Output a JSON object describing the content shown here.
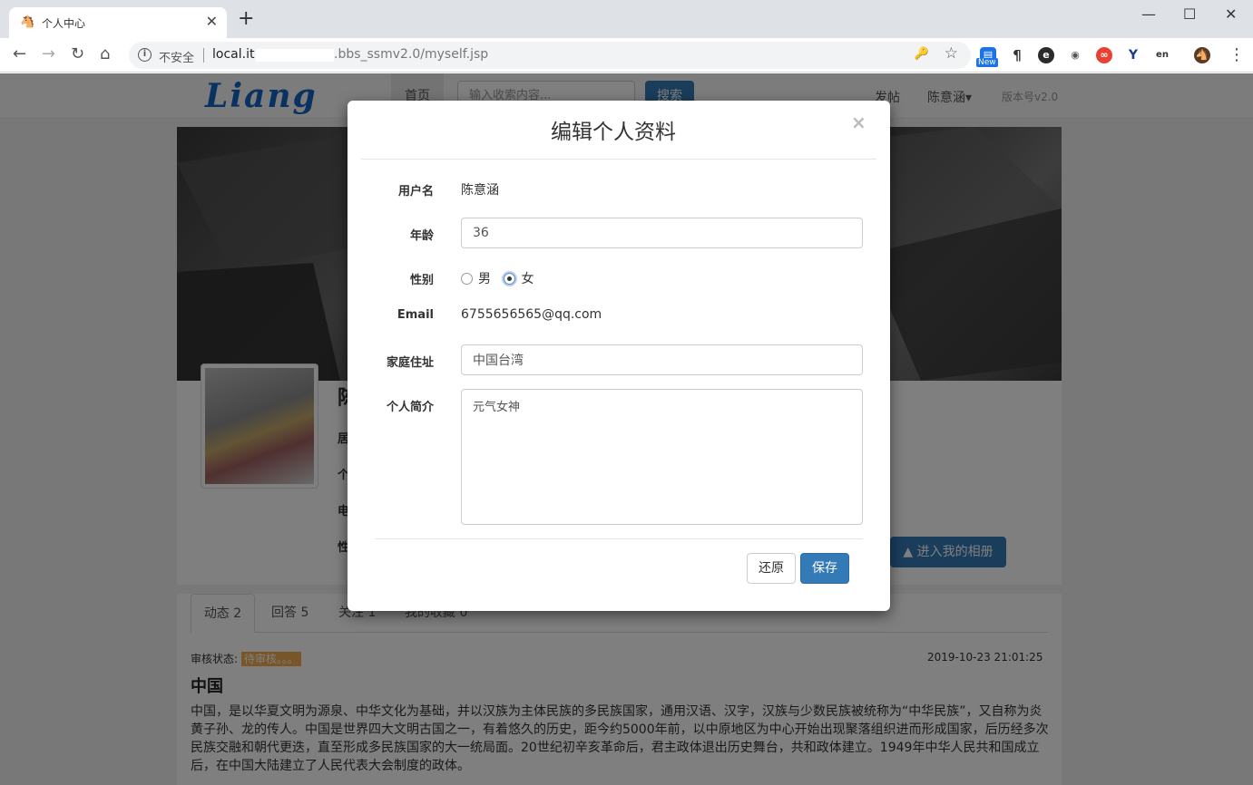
{
  "browser": {
    "tab_title": "个人中心",
    "security_label": "不安全",
    "url_host": "local.it.",
    "url_path": ".bbs_ssmv2.0/myself.jsp",
    "ext_new_badge": "New"
  },
  "nav": {
    "logo": "Liang",
    "home": "首页",
    "search_placeholder": "输入收索内容...",
    "search_button": "搜索",
    "post": "发帖",
    "user": "陈意涵▾",
    "version": "版本号v2.0"
  },
  "profile": {
    "name_initial": "陈",
    "label_residence": "居",
    "label_intro": "个",
    "label_phone": "电",
    "label_gender": "性",
    "album_button": "进入我的相册"
  },
  "tabs": [
    "动态 2",
    "回答 5",
    "关注 1",
    "我的收藏 0"
  ],
  "post": {
    "status_label": "审核状态:",
    "status_value": "待审核。。。",
    "date": "2019-10-23 21:01:25",
    "title": "中国",
    "body": "中国，是以华夏文明为源泉、中华文化为基础，并以汉族为主体民族的多民族国家，通用汉语、汉字，汉族与少数民族被统称为“中华民族”，又自称为炎黄子孙、龙的传人。中国是世界四大文明古国之一，有着悠久的历史，距今约5000年前，以中原地区为中心开始出现聚落组织进而形成国家，后历经多次民族交融和朝代更迭，直至形成多民族国家的大一统局面。20世纪初辛亥革命后，君主政体退出历史舞台，共和政体建立。1949年中华人民共和国成立后，在中国大陆建立了人民代表大会制度的政体。"
  },
  "modal": {
    "title": "编辑个人资料",
    "close": "×",
    "username_label": "用户名",
    "username_value": "陈意涵",
    "age_label": "年龄",
    "age_value": "36",
    "gender_label": "性别",
    "gender_male": "男",
    "gender_female": "女",
    "gender_selected": "女",
    "email_label": "Email",
    "email_value": "6755656565@qq.com",
    "address_label": "家庭住址",
    "address_value": "中国台湾",
    "intro_label": "个人简介",
    "intro_value": "元气女神",
    "reset_button": "还原",
    "save_button": "保存"
  },
  "colors": {
    "primary": "#337ab7",
    "warning": "#f0ad4e",
    "overlay": "rgba(0,0,0,0.5)"
  }
}
